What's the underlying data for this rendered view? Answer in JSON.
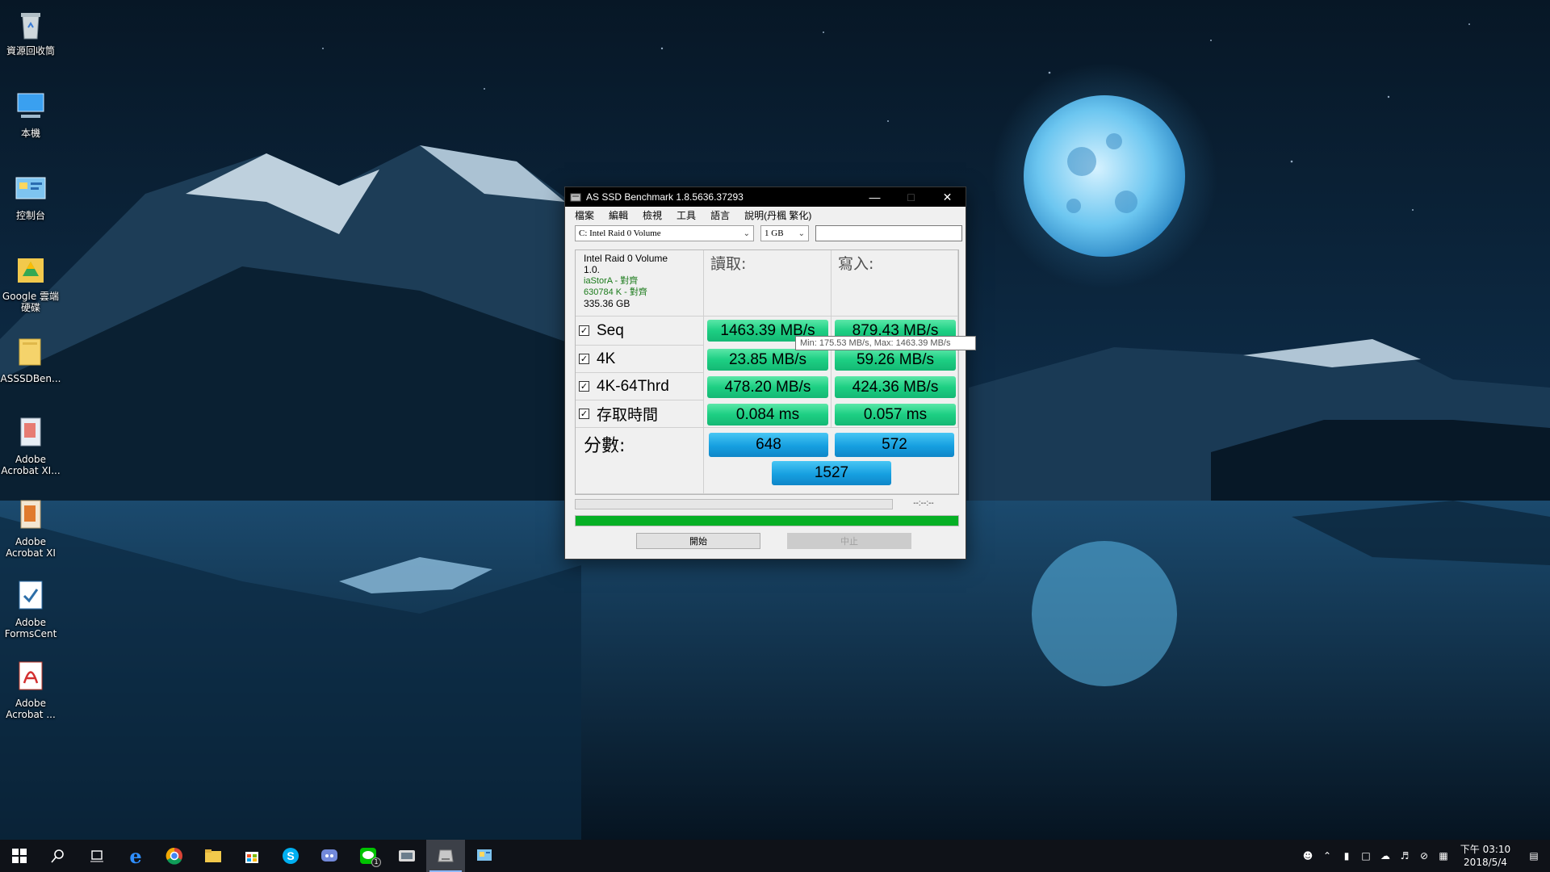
{
  "desktop": {
    "icons": [
      {
        "label": "資源回收筒",
        "icon": "recycle-bin-icon"
      },
      {
        "label": "本機",
        "icon": "computer-icon"
      },
      {
        "label": "控制台",
        "icon": "control-panel-icon"
      },
      {
        "label": "Google 雲端硬碟",
        "icon": "google-drive-icon"
      },
      {
        "label": "ASSSDBen...",
        "icon": "folder-icon"
      },
      {
        "label": "Adobe Acrobat XI...",
        "icon": "acrobat-distiller-icon"
      },
      {
        "label": "Adobe Acrobat XI",
        "icon": "acrobat-icon"
      },
      {
        "label": "Adobe FormsCent",
        "icon": "formscentral-icon"
      },
      {
        "label": "Adobe Acrobat ...",
        "icon": "acrobat-reader-icon"
      }
    ]
  },
  "window": {
    "title": "AS SSD Benchmark 1.8.5636.37293",
    "menu": [
      "檔案",
      "編輯",
      "檢視",
      "工具",
      "語言",
      "說明(丹楓 繁化)"
    ],
    "drive_select": "C: Intel Raid 0 Volume",
    "size_select": "1 GB",
    "drive_info": {
      "name": "Intel Raid 0 Volume",
      "version": "1.0.",
      "driver": "iaStorA - 對齊",
      "alignment": "630784 K - 對齊",
      "capacity": "335.36 GB"
    },
    "read_header": "讀取:",
    "write_header": "寫入:",
    "rows": [
      {
        "label": "Seq",
        "checked": true,
        "read": "1463.39 MB/s",
        "write": "879.43 MB/s"
      },
      {
        "label": "4K",
        "checked": true,
        "read": "23.85 MB/s",
        "write": "59.26 MB/s"
      },
      {
        "label": "4K-64Thrd",
        "checked": true,
        "read": "478.20 MB/s",
        "write": "424.36 MB/s"
      },
      {
        "label": "存取時間",
        "checked": true,
        "read": "0.084 ms",
        "write": "0.057 ms"
      }
    ],
    "score_label": "分數:",
    "score_read": "648",
    "score_write": "572",
    "score_total": "1527",
    "tooltip": "Min: 175.53 MB/s, Max: 1463.39 MB/s",
    "elapsed": "--:--:--",
    "progress_total": 1.0,
    "start_button": "開始",
    "abort_button": "中止",
    "colors": {
      "result": "#1dcf83",
      "score": "#169fe0",
      "progress": "#06b025"
    }
  },
  "taskbar": {
    "apps": [
      "start-icon",
      "search-icon",
      "task-view-icon",
      "edge-icon",
      "chrome-icon",
      "file-explorer-icon",
      "store-icon",
      "skype-icon",
      "discord-icon",
      "line-icon",
      "app-icon",
      "as-ssd-icon",
      "control-panel-icon"
    ],
    "line_badge": "1",
    "clock_time": "下午 03:10",
    "clock_date": "2018/5/4"
  }
}
